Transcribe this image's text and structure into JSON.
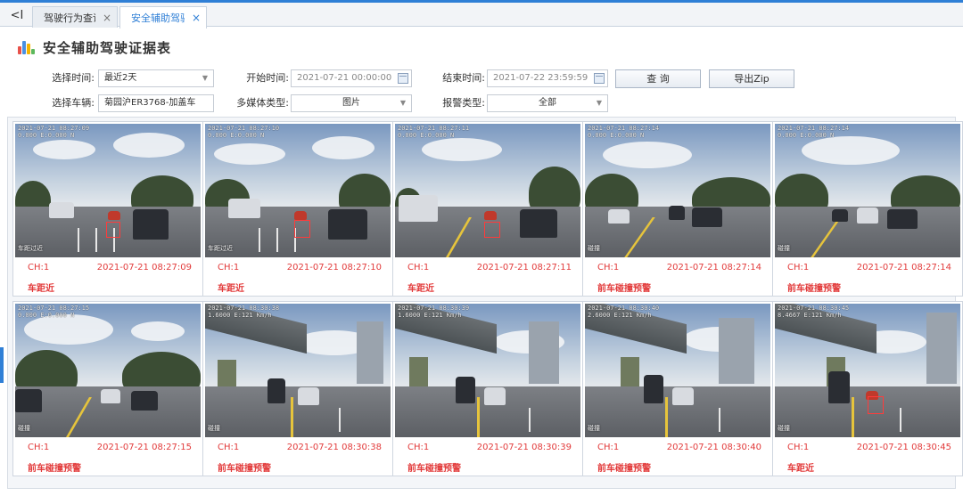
{
  "colors": {
    "accent": "#2f7fd6",
    "alarm_text": "#e23a3a"
  },
  "tabs": [
    {
      "label": "驾驶行为查询",
      "close": "×",
      "active": false
    },
    {
      "label": "安全辅助驾驶...",
      "close": "×",
      "active": true
    }
  ],
  "tab_back_icon": "collapse-left-icon",
  "tab_back_glyph": "<I",
  "page": {
    "title": "安全辅助驾驶证据表",
    "icon": "bar-chart-icon"
  },
  "filters": {
    "time_label": "选择时间:",
    "time_value": "最近2天",
    "start_label": "开始时间:",
    "start_value": "2021-07-21 00:00:00",
    "end_label": "结束时间:",
    "end_value": "2021-07-22 23:59:59",
    "query_button": "查 询",
    "export_button": "导出Zip",
    "vehicle_label": "选择车辆:",
    "vehicle_value": "菊园沪ER3768-加盖车",
    "media_label": "多媒体类型:",
    "media_value": "图片",
    "alarm_label": "报警类型:",
    "alarm_value": "全部"
  },
  "evidence": [
    {
      "channel": "CH:1",
      "time": "2021-07-21 08:27:09",
      "type": "车距近",
      "overlay": "2021-07-21 08:27:09\n0.000 E:0.000 N",
      "caption": "车距过近"
    },
    {
      "channel": "CH:1",
      "time": "2021-07-21 08:27:10",
      "type": "车距近",
      "overlay": "2021-07-21 08:27:10\n0.000 E:0.000 N",
      "caption": "车距过近"
    },
    {
      "channel": "CH:1",
      "time": "2021-07-21 08:27:11",
      "type": "车距近",
      "overlay": "2021-07-21 08:27:11\n0.000 E:0.000 N",
      "caption": ""
    },
    {
      "channel": "CH:1",
      "time": "2021-07-21 08:27:14",
      "type": "前车碰撞预警",
      "overlay": "2021-07-21 08:27:14\n0.000 E:0.000 N",
      "caption": "碰撞"
    },
    {
      "channel": "CH:1",
      "time": "2021-07-21 08:27:14",
      "type": "前车碰撞预警",
      "overlay": "2021-07-21 08:27:14\n0.000 E:0.000 N",
      "caption": "碰撞"
    },
    {
      "channel": "CH:1",
      "time": "2021-07-21 08:27:15",
      "type": "前车碰撞预警",
      "overlay": "2021-07-21 08:27:15\n0.000 E:0.000 N",
      "caption": "碰撞"
    },
    {
      "channel": "CH:1",
      "time": "2021-07-21 08:30:38",
      "type": "前车碰撞预警",
      "overlay": "2021-07-21 08:30:38\n1.6000 E:121 Km/h",
      "caption": "碰撞"
    },
    {
      "channel": "CH:1",
      "time": "2021-07-21 08:30:39",
      "type": "前车碰撞预警",
      "overlay": "2021-07-21 08:30:39\n1.6000 E:121 Km/h",
      "caption": ""
    },
    {
      "channel": "CH:1",
      "time": "2021-07-21 08:30:40",
      "type": "前车碰撞预警",
      "overlay": "2021-07-21 08:30:40\n2.6000 E:121 Km/h",
      "caption": "碰撞"
    },
    {
      "channel": "CH:1",
      "time": "2021-07-21 08:30:45",
      "type": "车距近",
      "overlay": "2021-07-21 08:30:45\n8.4667 E:121 Km/h",
      "caption": "碰撞"
    }
  ]
}
